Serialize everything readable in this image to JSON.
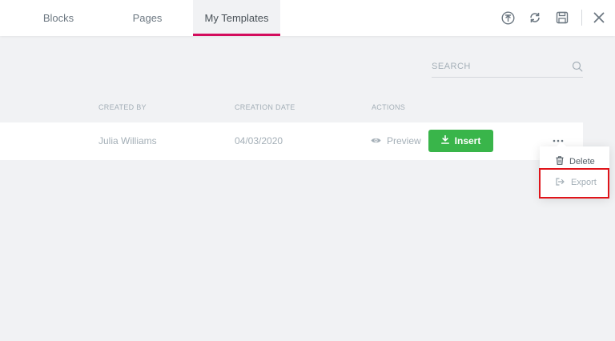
{
  "tabs": [
    {
      "label": "Blocks",
      "active": false
    },
    {
      "label": "Pages",
      "active": false
    },
    {
      "label": "My Templates",
      "active": true
    }
  ],
  "toolbar": {
    "icons": [
      "upload-icon",
      "sync-icon",
      "save-icon",
      "close-icon"
    ]
  },
  "search": {
    "placeholder": "SEARCH",
    "value": ""
  },
  "table": {
    "headers": [
      "CREATED BY",
      "CREATION DATE",
      "ACTIONS"
    ],
    "rows": [
      {
        "created_by": "Julia Williams",
        "creation_date": "04/03/2020",
        "preview_label": "Preview",
        "insert_label": "Insert"
      }
    ]
  },
  "menu": {
    "items": [
      {
        "label": "Delete",
        "icon": "trash-icon"
      },
      {
        "label": "Export",
        "icon": "export-icon"
      }
    ]
  },
  "colors": {
    "accent": "#d30c5c",
    "insert": "#39b54a",
    "highlight": "#e0141a",
    "background": "#f1f2f4"
  }
}
